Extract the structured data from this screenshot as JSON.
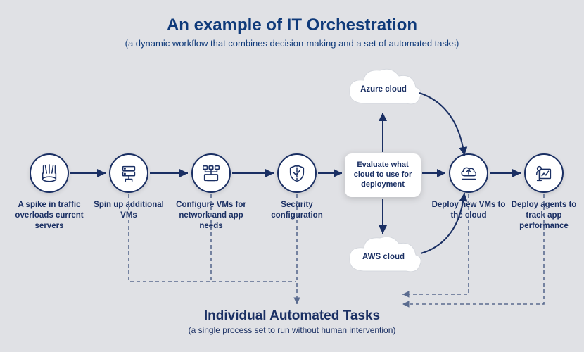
{
  "header": {
    "title": "An example of IT Orchestration",
    "subtitle": "(a dynamic workflow that combines decision-making and a set of automated tasks)"
  },
  "nodes": {
    "n1": "A spike in traffic overloads current  servers",
    "n2": "Spin up additional VMs",
    "n3": "Configure VMs for network and app needs",
    "n4": "Security configuration",
    "n5": "Deploy new VMs to the cloud",
    "n6": "Deploy agents to track app performance"
  },
  "decision": "Evaluate what cloud to use for deployment",
  "clouds": {
    "azure": "Azure cloud",
    "aws": "AWS cloud"
  },
  "footer": {
    "title": "Individual Automated Tasks",
    "subtitle": "(a single process set to run without human intervention)"
  },
  "colors": {
    "primary": "#1a2f63",
    "title": "#0f3a7a",
    "bg": "#e0e1e5"
  }
}
